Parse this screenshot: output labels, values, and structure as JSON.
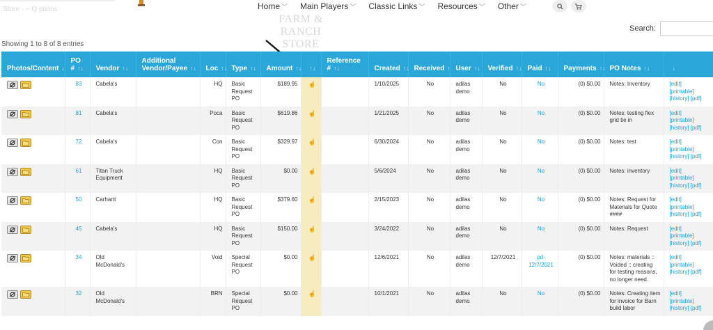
{
  "topbar": {
    "faint_text": "Store  ·  ~ Q  ptions"
  },
  "nav": {
    "items": [
      {
        "label": "Home"
      },
      {
        "label": "Main Players"
      },
      {
        "label": "Classic Links"
      },
      {
        "label": "Resources"
      },
      {
        "label": "Other"
      }
    ]
  },
  "store_faint": {
    "line1": "FARM & RANCH",
    "line2": "STORE"
  },
  "search": {
    "label": "Search:",
    "value": ""
  },
  "showing": "Showing 1 to 8 of 8 entries",
  "columns": [
    "Photos/Content",
    "PO #",
    "Vendor",
    "Additional Vendor/Payee",
    "Loc",
    "Type",
    "Amount",
    "",
    "Reference #",
    "Created",
    "Received",
    "User",
    "Verified",
    "Paid",
    "Payments",
    "PO Notes",
    ""
  ],
  "rows": [
    {
      "po": "83",
      "vendor": "Cabela's",
      "additional": "",
      "loc": "HQ",
      "type": "Basic Request PO",
      "amount": "$189.95",
      "reference": "",
      "created": "1/10/2025",
      "received": "No",
      "user": "adilas demo",
      "verified": "No",
      "paid": "No",
      "payments": "(0) $0.00",
      "notes": "Notes: Inventory"
    },
    {
      "po": "81",
      "vendor": "Cabela's",
      "additional": "",
      "loc": "Poca",
      "type": "Basic Request PO",
      "amount": "$619.86",
      "reference": "",
      "created": "1/21/2025",
      "received": "No",
      "user": "adilas demo",
      "verified": "No",
      "paid": "No",
      "payments": "(0) $0.00",
      "notes": "Notes: testing flex grid tie in"
    },
    {
      "po": "72",
      "vendor": "Cabela's",
      "additional": "",
      "loc": "Con",
      "type": "Basic Request PO",
      "amount": "$329.97",
      "reference": "",
      "created": "6/30/2024",
      "received": "No",
      "user": "adilas demo",
      "verified": "No",
      "paid": "No",
      "payments": "(0) $0.00",
      "notes": "Notes: test"
    },
    {
      "po": "61",
      "vendor": "Titan Truck Equipment",
      "additional": "",
      "loc": "HQ",
      "type": "Basic Request PO",
      "amount": "$0.00",
      "reference": "",
      "created": "5/6/2024",
      "received": "No",
      "user": "adilas demo",
      "verified": "No",
      "paid": "No",
      "payments": "(0) $0.00",
      "notes": "Notes: inventory"
    },
    {
      "po": "50",
      "vendor": "Carhartt",
      "additional": "",
      "loc": "HQ",
      "type": "Basic Request PO",
      "amount": "$379.60",
      "reference": "",
      "created": "2/15/2023",
      "received": "No",
      "user": "adilas demo",
      "verified": "No",
      "paid": "No",
      "payments": "(0) $0.00",
      "notes": "Notes: Request for Materials for Quote ####"
    },
    {
      "po": "45",
      "vendor": "Cabela's",
      "additional": "",
      "loc": "HQ",
      "type": "Basic Request PO",
      "amount": "$150.00",
      "reference": "",
      "created": "3/24/2022",
      "received": "No",
      "user": "adilas demo",
      "verified": "No",
      "paid": "No",
      "payments": "(0) $0.00",
      "notes": "Notes: Request"
    },
    {
      "po": "34",
      "vendor": "Old McDonald's",
      "additional": "",
      "loc": "Void",
      "type": "Special Request PO",
      "amount": "$0.00",
      "reference": "",
      "created": "12/6/2021",
      "received": "No",
      "user": "adilas demo",
      "verified": "12/7/2021",
      "paid": "pd-12/7/2021",
      "payments": "(0) $0.00",
      "notes": "Notes: materials :: Voided :: creating for testing reasons, no longer need."
    },
    {
      "po": "32",
      "vendor": "Old McDonald's",
      "additional": "",
      "loc": "BRN",
      "type": "Special Request PO",
      "amount": "$0.00",
      "reference": "",
      "created": "10/1/2021",
      "received": "No",
      "user": "adilas demo",
      "verified": "No",
      "paid": "No",
      "payments": "(0) $0.00",
      "notes": "Notes: Creating item for invoice for Barn build labor"
    }
  ],
  "actions": {
    "edit": "[edit]",
    "printable": "[printable]",
    "history": "[history]",
    "pdf": "[pdf]"
  },
  "icons": {
    "sort": "sort-icon",
    "photo": "camera-icon",
    "folder": "folder-icon",
    "hand": "hand-pointer-icon",
    "search": "search-icon",
    "cart": "cart-icon"
  },
  "colors": {
    "header_bg": "#2aa7d8",
    "link": "#1a9fd8",
    "highlight_col": "#f6ecbf",
    "row_alt": "#f2f2f2"
  }
}
